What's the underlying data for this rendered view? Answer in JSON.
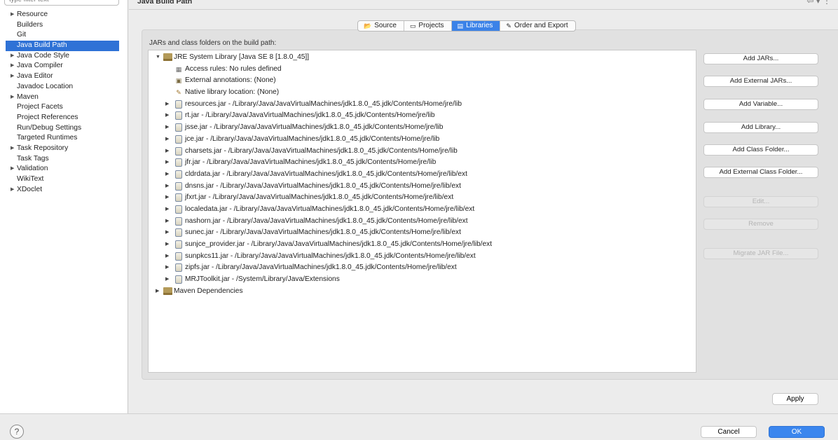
{
  "window": {
    "header_title": "Java Build Path",
    "filter_placeholder": "type filter text"
  },
  "sidebar": {
    "items": [
      {
        "label": "Resource",
        "expandable": true,
        "selected": false
      },
      {
        "label": "Builders",
        "expandable": false,
        "selected": false
      },
      {
        "label": "Git",
        "expandable": false,
        "selected": false
      },
      {
        "label": "Java Build Path",
        "expandable": false,
        "selected": true
      },
      {
        "label": "Java Code Style",
        "expandable": true,
        "selected": false
      },
      {
        "label": "Java Compiler",
        "expandable": true,
        "selected": false
      },
      {
        "label": "Java Editor",
        "expandable": true,
        "selected": false
      },
      {
        "label": "Javadoc Location",
        "expandable": false,
        "selected": false
      },
      {
        "label": "Maven",
        "expandable": true,
        "selected": false
      },
      {
        "label": "Project Facets",
        "expandable": false,
        "selected": false
      },
      {
        "label": "Project References",
        "expandable": false,
        "selected": false
      },
      {
        "label": "Run/Debug Settings",
        "expandable": false,
        "selected": false
      },
      {
        "label": "Targeted Runtimes",
        "expandable": false,
        "selected": false
      },
      {
        "label": "Task Repository",
        "expandable": true,
        "selected": false
      },
      {
        "label": "Task Tags",
        "expandable": false,
        "selected": false
      },
      {
        "label": "Validation",
        "expandable": true,
        "selected": false
      },
      {
        "label": "WikiText",
        "expandable": false,
        "selected": false
      },
      {
        "label": "XDoclet",
        "expandable": true,
        "selected": false
      }
    ]
  },
  "tabs": [
    {
      "label": "Source",
      "icon": "source-icon",
      "active": false
    },
    {
      "label": "Projects",
      "icon": "projects-icon",
      "active": false
    },
    {
      "label": "Libraries",
      "icon": "libraries-icon",
      "active": true
    },
    {
      "label": "Order and Export",
      "icon": "order-export-icon",
      "active": false
    }
  ],
  "build_path_label": "JARs and class folders on the build path:",
  "tree": [
    {
      "label": "JRE System Library [Java SE 8 [1.8.0_45]]",
      "level": 0,
      "arrow": "down",
      "icon": "library"
    },
    {
      "label": "Access rules: No rules defined",
      "level": 1,
      "arrow": "",
      "icon": "access-rules"
    },
    {
      "label": "External annotations: (None)",
      "level": 1,
      "arrow": "",
      "icon": "annotations"
    },
    {
      "label": "Native library location: (None)",
      "level": 1,
      "arrow": "",
      "icon": "native-library"
    },
    {
      "label": "resources.jar - /Library/Java/JavaVirtualMachines/jdk1.8.0_45.jdk/Contents/Home/jre/lib",
      "level": 1,
      "arrow": "right",
      "icon": "jar"
    },
    {
      "label": "rt.jar - /Library/Java/JavaVirtualMachines/jdk1.8.0_45.jdk/Contents/Home/jre/lib",
      "level": 1,
      "arrow": "right",
      "icon": "jar"
    },
    {
      "label": "jsse.jar - /Library/Java/JavaVirtualMachines/jdk1.8.0_45.jdk/Contents/Home/jre/lib",
      "level": 1,
      "arrow": "right",
      "icon": "jar"
    },
    {
      "label": "jce.jar - /Library/Java/JavaVirtualMachines/jdk1.8.0_45.jdk/Contents/Home/jre/lib",
      "level": 1,
      "arrow": "right",
      "icon": "jar"
    },
    {
      "label": "charsets.jar - /Library/Java/JavaVirtualMachines/jdk1.8.0_45.jdk/Contents/Home/jre/lib",
      "level": 1,
      "arrow": "right",
      "icon": "jar"
    },
    {
      "label": "jfr.jar - /Library/Java/JavaVirtualMachines/jdk1.8.0_45.jdk/Contents/Home/jre/lib",
      "level": 1,
      "arrow": "right",
      "icon": "jar"
    },
    {
      "label": "cldrdata.jar - /Library/Java/JavaVirtualMachines/jdk1.8.0_45.jdk/Contents/Home/jre/lib/ext",
      "level": 1,
      "arrow": "right",
      "icon": "jar"
    },
    {
      "label": "dnsns.jar - /Library/Java/JavaVirtualMachines/jdk1.8.0_45.jdk/Contents/Home/jre/lib/ext",
      "level": 1,
      "arrow": "right",
      "icon": "jar"
    },
    {
      "label": "jfxrt.jar - /Library/Java/JavaVirtualMachines/jdk1.8.0_45.jdk/Contents/Home/jre/lib/ext",
      "level": 1,
      "arrow": "right",
      "icon": "jar"
    },
    {
      "label": "localedata.jar - /Library/Java/JavaVirtualMachines/jdk1.8.0_45.jdk/Contents/Home/jre/lib/ext",
      "level": 1,
      "arrow": "right",
      "icon": "jar"
    },
    {
      "label": "nashorn.jar - /Library/Java/JavaVirtualMachines/jdk1.8.0_45.jdk/Contents/Home/jre/lib/ext",
      "level": 1,
      "arrow": "right",
      "icon": "jar"
    },
    {
      "label": "sunec.jar - /Library/Java/JavaVirtualMachines/jdk1.8.0_45.jdk/Contents/Home/jre/lib/ext",
      "level": 1,
      "arrow": "right",
      "icon": "jar"
    },
    {
      "label": "sunjce_provider.jar - /Library/Java/JavaVirtualMachines/jdk1.8.0_45.jdk/Contents/Home/jre/lib/ext",
      "level": 1,
      "arrow": "right",
      "icon": "jar"
    },
    {
      "label": "sunpkcs11.jar - /Library/Java/JavaVirtualMachines/jdk1.8.0_45.jdk/Contents/Home/jre/lib/ext",
      "level": 1,
      "arrow": "right",
      "icon": "jar"
    },
    {
      "label": "zipfs.jar - /Library/Java/JavaVirtualMachines/jdk1.8.0_45.jdk/Contents/Home/jre/lib/ext",
      "level": 1,
      "arrow": "right",
      "icon": "jar"
    },
    {
      "label": "MRJToolkit.jar - /System/Library/Java/Extensions",
      "level": 1,
      "arrow": "right",
      "icon": "jar"
    },
    {
      "label": "Maven Dependencies",
      "level": 0,
      "arrow": "right",
      "icon": "library"
    }
  ],
  "buttons": [
    {
      "label": "Add JARs...",
      "enabled": true,
      "name": "add-jars-button"
    },
    {
      "label": "Add External JARs...",
      "enabled": true,
      "name": "add-external-jars-button"
    },
    {
      "label": "Add Variable...",
      "enabled": true,
      "name": "add-variable-button"
    },
    {
      "label": "Add Library...",
      "enabled": true,
      "name": "add-library-button"
    },
    {
      "label": "Add Class Folder...",
      "enabled": true,
      "name": "add-class-folder-button"
    },
    {
      "label": "Add External Class Folder...",
      "enabled": true,
      "name": "add-external-class-folder-button"
    },
    {
      "label": "Edit...",
      "enabled": false,
      "name": "edit-button"
    },
    {
      "label": "Remove",
      "enabled": false,
      "name": "remove-button"
    },
    {
      "label": "Migrate JAR File...",
      "enabled": false,
      "name": "migrate-jar-file-button"
    }
  ],
  "apply_label": "Apply",
  "footer": {
    "help_glyph": "?",
    "cancel_label": "Cancel",
    "ok_label": "OK"
  }
}
